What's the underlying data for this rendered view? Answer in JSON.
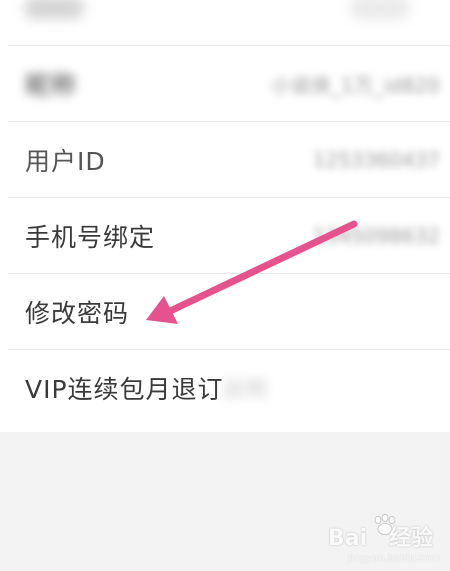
{
  "settings": {
    "rows": [
      {
        "label": "",
        "value": ""
      },
      {
        "label": "昵称",
        "value": "小说侠_1万_id820"
      },
      {
        "label": "用户ID",
        "value": "1253360437"
      },
      {
        "label": "手机号绑定",
        "value": "1345098632"
      },
      {
        "label": "修改密码",
        "value": ""
      },
      {
        "label": "VIP连续包月退订",
        "value": "说明"
      }
    ]
  },
  "annotation": {
    "arrow_color": "#e5528e"
  },
  "watermark": {
    "brand": "Bai",
    "suffix": "经验",
    "domain": "jingyan.baidu.com"
  }
}
